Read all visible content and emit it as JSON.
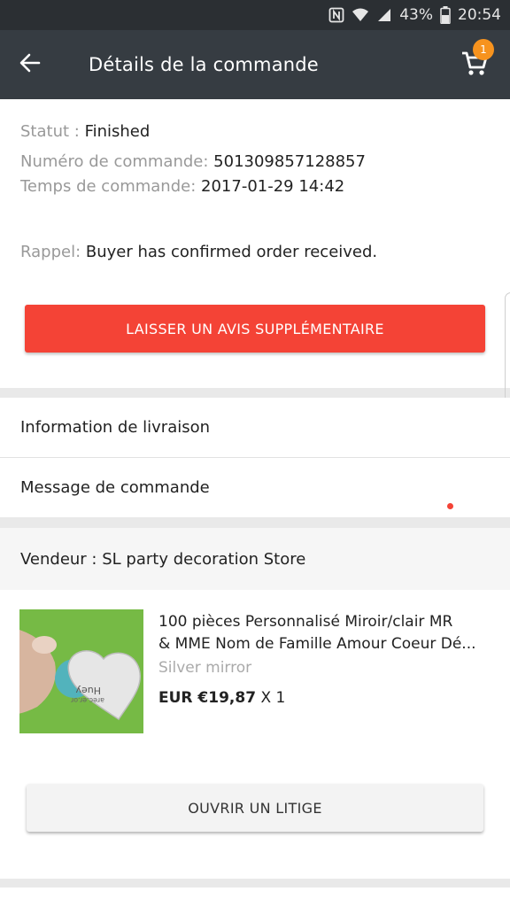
{
  "status_bar": {
    "battery_percent": "43%",
    "time": "20:54",
    "icons": [
      "nfc-icon",
      "wifi-icon",
      "signal-icon",
      "battery-icon"
    ]
  },
  "app_bar": {
    "title": "Détails de la commande",
    "cart_count": "1",
    "accent": "#f7931e"
  },
  "order": {
    "status_label": "Statut :",
    "status_value": "Finished",
    "number_label": "Numéro de commande:",
    "number_value": "501309857128857",
    "time_label": "Temps de commande:",
    "time_value": "2017-01-29 14:42",
    "reminder_label": "Rappel:",
    "reminder_value": "Buyer has confirmed order received.",
    "review_button": "LAISSER UN AVIS SUPPLÉMENTAIRE"
  },
  "sections": {
    "shipping": "Information de livraison",
    "message": "Message de commande"
  },
  "seller": {
    "label": "Vendeur :",
    "name": "SL party decoration Store"
  },
  "product": {
    "title_line1": "100 pièces Personnalisé Miroir/clair MR",
    "title_line2": "& MME Nom de Famille Amour Coeur Dé...",
    "variant": "Silver mirror",
    "price": "EUR €19,87",
    "quantity": "X 1",
    "dispute_button": "OUVRIR UN LITIGE"
  },
  "colors": {
    "primary_red": "#f44336",
    "app_bar": "#363c42",
    "status_bar": "#2b2f33"
  }
}
